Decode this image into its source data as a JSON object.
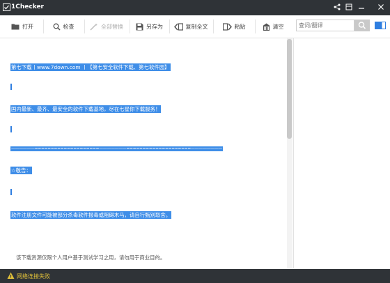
{
  "app": {
    "title": "1Checker"
  },
  "window_controls": [
    "share-icon",
    "skin-icon",
    "minimize-icon",
    "close-icon"
  ],
  "toolbar": {
    "open": "打开",
    "check": "检查",
    "replace_all": "全部替换",
    "save_as": "另存为",
    "copy_all": "复制全文",
    "paste": "粘贴",
    "clear": "清空"
  },
  "search": {
    "placeholder": "查词/翻译"
  },
  "document": {
    "lines": [
      "第七下载丨www.7down.com 丨【第七安全软件下载、第七软件园】",
      "国内最新、最齐、最安全的软件下载基地，尽在七星你下载服务！",
      "——————====================———————====================————————",
      "☆敬告：",
      "软件注册文件可能被部分杀毒软件报毒或阻碍木马，请自行甄别取舍。",
      "该下载资源仅限个人用户基于测试学习之用，请勿用于商业目的。"
    ]
  },
  "status": {
    "message": "网络连接失败"
  },
  "colors": {
    "chrome": "#2f3337",
    "selection": "#3f8ee8",
    "accent": "#2f7ee0",
    "warning": "#e0c03a"
  }
}
